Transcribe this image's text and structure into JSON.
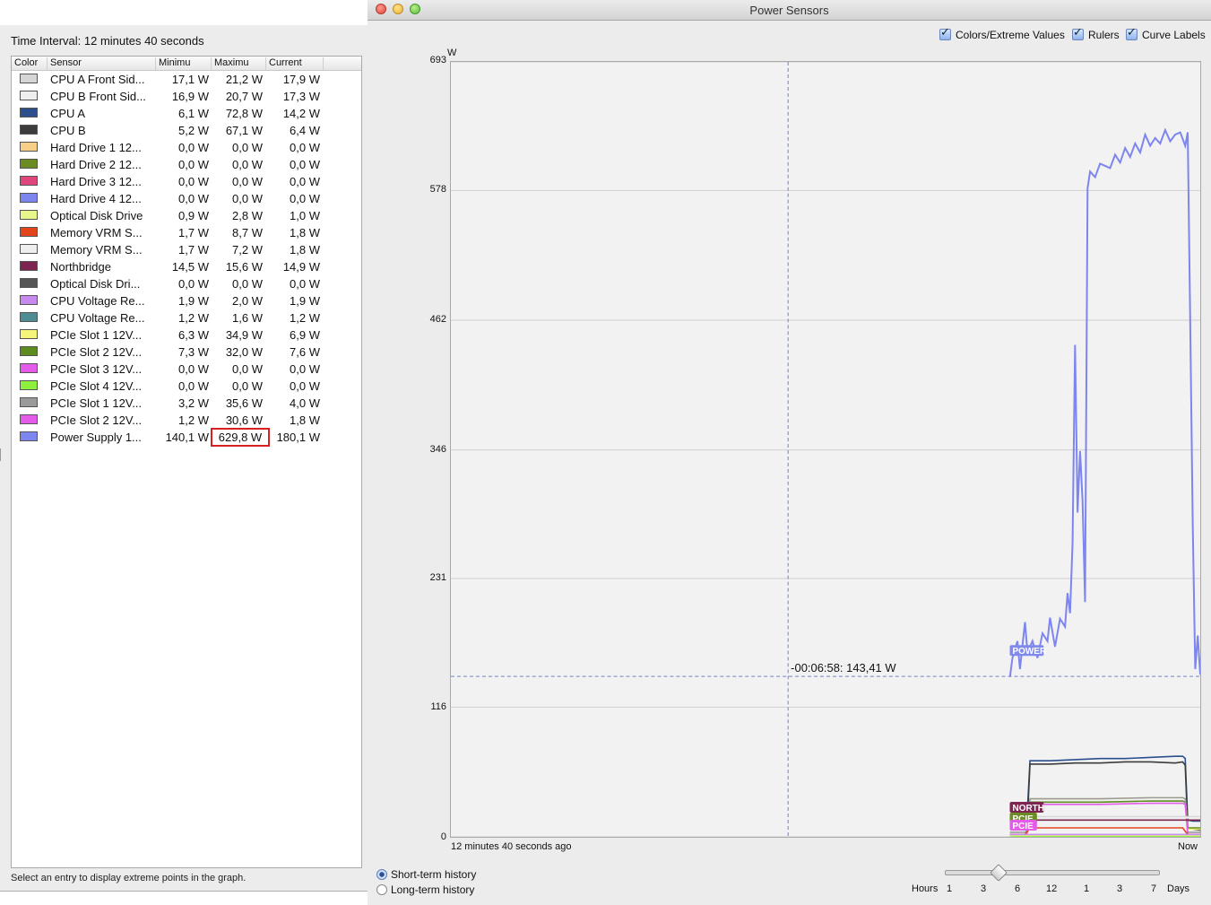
{
  "left": {
    "time_interval": "Time Interval: 12 minutes 40 seconds",
    "columns": [
      "Color",
      "Sensor",
      "Minimu",
      "Maximu",
      "Current"
    ],
    "status": "Select an entry to display extreme points in the graph.",
    "sensors": [
      {
        "color": "#d6d6d6",
        "name": "CPU A Front Sid...",
        "min": "17,1 W",
        "max": "21,2 W",
        "current": "17,9 W"
      },
      {
        "color": "#eeeeee",
        "name": "CPU B Front Sid...",
        "min": "16,9 W",
        "max": "20,7 W",
        "current": "17,3 W"
      },
      {
        "color": "#2a4f8c",
        "name": "CPU A",
        "min": "6,1 W",
        "max": "72,8 W",
        "current": "14,2 W"
      },
      {
        "color": "#3c3c3c",
        "name": "CPU B",
        "min": "5,2 W",
        "max": "67,1 W",
        "current": "6,4 W"
      },
      {
        "color": "#f7cf86",
        "name": "Hard Drive 1 12...",
        "min": "0,0 W",
        "max": "0,0 W",
        "current": "0,0 W"
      },
      {
        "color": "#6b8c23",
        "name": "Hard Drive 2 12...",
        "min": "0,0 W",
        "max": "0,0 W",
        "current": "0,0 W"
      },
      {
        "color": "#e0457e",
        "name": "Hard Drive 3 12...",
        "min": "0,0 W",
        "max": "0,0 W",
        "current": "0,0 W"
      },
      {
        "color": "#7d85ee",
        "name": "Hard Drive 4 12...",
        "min": "0,0 W",
        "max": "0,0 W",
        "current": "0,0 W"
      },
      {
        "color": "#e8f58a",
        "name": "Optical Disk Drive",
        "min": "0,9 W",
        "max": "2,8 W",
        "current": "1,0 W"
      },
      {
        "color": "#e2441c",
        "name": "Memory VRM S...",
        "min": "1,7 W",
        "max": "8,7 W",
        "current": "1,8 W"
      },
      {
        "color": "#eeeeee",
        "name": "Memory VRM S...",
        "min": "1,7 W",
        "max": "7,2 W",
        "current": "1,8 W"
      },
      {
        "color": "#7d2450",
        "name": "Northbridge",
        "min": "14,5 W",
        "max": "15,6 W",
        "current": "14,9 W"
      },
      {
        "color": "#555555",
        "name": "Optical Disk Dri...",
        "min": "0,0 W",
        "max": "0,0 W",
        "current": "0,0 W"
      },
      {
        "color": "#c889ee",
        "name": "CPU Voltage Re...",
        "min": "1,9 W",
        "max": "2,0 W",
        "current": "1,9 W"
      },
      {
        "color": "#4f8d94",
        "name": "CPU Voltage Re...",
        "min": "1,2 W",
        "max": "1,6 W",
        "current": "1,2 W"
      },
      {
        "color": "#f6f57a",
        "name": "PCIe Slot 1 12V...",
        "min": "6,3 W",
        "max": "34,9 W",
        "current": "6,9 W"
      },
      {
        "color": "#5c8c1e",
        "name": "PCIe Slot 2 12V...",
        "min": "7,3 W",
        "max": "32,0 W",
        "current": "7,6 W"
      },
      {
        "color": "#e35be8",
        "name": "PCIe Slot 3 12V...",
        "min": "0,0 W",
        "max": "0,0 W",
        "current": "0,0 W"
      },
      {
        "color": "#8ef03c",
        "name": "PCIe Slot 4 12V...",
        "min": "0,0 W",
        "max": "0,0 W",
        "current": "0,0 W"
      },
      {
        "color": "#9a9a9a",
        "name": "PCIe Slot 1 12V...",
        "min": "3,2 W",
        "max": "35,6 W",
        "current": "4,0 W"
      },
      {
        "color": "#e35be8",
        "name": "PCIe Slot 2 12V...",
        "min": "1,2 W",
        "max": "30,6 W",
        "current": "1,8 W"
      },
      {
        "color": "#7d85ee",
        "name": "Power Supply 1...",
        "min": "140,1 W",
        "max": "629,8 W",
        "current": "180,1 W",
        "highlight_max": true
      }
    ]
  },
  "window": {
    "title": "Power Sensors",
    "options": [
      {
        "label": "Colors/Extreme Values",
        "checked": true
      },
      {
        "label": "Rulers",
        "checked": true
      },
      {
        "label": "Curve Labels",
        "checked": true
      }
    ],
    "history": {
      "short_label": "Short-term history",
      "long_label": "Long-term history",
      "selected": "short"
    },
    "scale": {
      "hours_label": "Hours",
      "ticks": [
        "1",
        "3",
        "6",
        "12",
        "1",
        "3",
        "7"
      ],
      "days_label": "Days"
    }
  },
  "chart_data": {
    "type": "line",
    "ylabel": "W",
    "yticks": [
      "693",
      "578",
      "462",
      "346",
      "231",
      "116",
      "0"
    ],
    "ylim": [
      0,
      693
    ],
    "x_left_label": "12 minutes 40 seconds ago",
    "x_right_label": "Now",
    "x_domain_seconds_ago": [
      760,
      0
    ],
    "grid": true,
    "cursor": {
      "label": "-00:06:58: 143,41 W",
      "seconds_ago": 418,
      "value": 143.41
    },
    "curve_labels": [
      "POWER",
      "NORTH",
      "PCIE",
      "PCIE"
    ],
    "series": [
      {
        "name": "Power Supply 1...",
        "color": "#7d85ee",
        "points": [
          [
            76,
            143
          ],
          [
            75,
            160
          ],
          [
            73,
            175
          ],
          [
            72,
            150
          ],
          [
            70,
            192
          ],
          [
            69,
            165
          ],
          [
            67,
            175
          ],
          [
            65,
            160
          ],
          [
            63,
            182
          ],
          [
            61,
            175
          ],
          [
            60,
            196
          ],
          [
            58,
            170
          ],
          [
            56,
            195
          ],
          [
            54,
            188
          ],
          [
            53,
            218
          ],
          [
            52,
            200
          ],
          [
            51,
            262
          ],
          [
            50,
            440
          ],
          [
            49,
            290
          ],
          [
            48,
            345
          ],
          [
            47,
            300
          ],
          [
            46,
            210
          ],
          [
            45,
            580
          ],
          [
            44,
            595
          ],
          [
            42,
            590
          ],
          [
            40,
            602
          ],
          [
            38,
            600
          ],
          [
            36,
            598
          ],
          [
            34,
            610
          ],
          [
            32,
            603
          ],
          [
            30,
            616
          ],
          [
            28,
            608
          ],
          [
            26,
            620
          ],
          [
            24,
            612
          ],
          [
            22,
            628
          ],
          [
            20,
            618
          ],
          [
            18,
            625
          ],
          [
            16,
            620
          ],
          [
            14,
            632
          ],
          [
            12,
            622
          ],
          [
            10,
            628
          ],
          [
            8,
            630
          ],
          [
            7,
            624
          ],
          [
            6,
            618
          ],
          [
            5,
            630
          ],
          [
            4,
            460
          ],
          [
            3,
            280
          ],
          [
            2,
            150
          ],
          [
            1,
            180
          ],
          [
            0,
            145
          ]
        ]
      },
      {
        "name": "CPU A",
        "color": "#2a4f8c",
        "points": [
          [
            76,
            20
          ],
          [
            73,
            22
          ],
          [
            70,
            23
          ],
          [
            69,
            25
          ],
          [
            68,
            68
          ],
          [
            60,
            68
          ],
          [
            50,
            69
          ],
          [
            40,
            70
          ],
          [
            30,
            70
          ],
          [
            20,
            71
          ],
          [
            10,
            72
          ],
          [
            7,
            72
          ],
          [
            6,
            70
          ],
          [
            5,
            15
          ],
          [
            3,
            14
          ],
          [
            0,
            14
          ]
        ]
      },
      {
        "name": "CPU B",
        "color": "#3c3c3c",
        "points": [
          [
            76,
            12
          ],
          [
            73,
            14
          ],
          [
            70,
            15
          ],
          [
            69,
            17
          ],
          [
            68,
            65
          ],
          [
            60,
            65
          ],
          [
            50,
            66
          ],
          [
            40,
            66
          ],
          [
            30,
            67
          ],
          [
            20,
            67
          ],
          [
            10,
            66
          ],
          [
            7,
            67
          ],
          [
            6,
            64
          ],
          [
            5,
            8
          ],
          [
            3,
            7
          ],
          [
            0,
            6
          ]
        ]
      },
      {
        "name": "PCIe Slot 1 12V...",
        "color": "#f6f57a",
        "points": [
          [
            76,
            8
          ],
          [
            70,
            8
          ],
          [
            69,
            10
          ],
          [
            68,
            34
          ],
          [
            40,
            34
          ],
          [
            20,
            35
          ],
          [
            7,
            35
          ],
          [
            6,
            34
          ],
          [
            5,
            7
          ],
          [
            0,
            7
          ]
        ]
      },
      {
        "name": "PCIe Slot 2 12V...",
        "color": "#5c8c1e",
        "points": [
          [
            76,
            9
          ],
          [
            70,
            9
          ],
          [
            69,
            11
          ],
          [
            68,
            31
          ],
          [
            40,
            31
          ],
          [
            20,
            32
          ],
          [
            7,
            32
          ],
          [
            6,
            31
          ],
          [
            5,
            8
          ],
          [
            0,
            8
          ]
        ]
      },
      {
        "name": "PCIe Slot 1 12V...",
        "color": "#9a9a9a",
        "points": [
          [
            76,
            4
          ],
          [
            70,
            4
          ],
          [
            69,
            6
          ],
          [
            68,
            34
          ],
          [
            40,
            34
          ],
          [
            20,
            35
          ],
          [
            7,
            35
          ],
          [
            6,
            34
          ],
          [
            5,
            4
          ],
          [
            0,
            4
          ]
        ]
      },
      {
        "name": "PCIe Slot 2 12V...",
        "color": "#e35be8",
        "points": [
          [
            76,
            2
          ],
          [
            70,
            2
          ],
          [
            69,
            4
          ],
          [
            68,
            29
          ],
          [
            40,
            29
          ],
          [
            20,
            30
          ],
          [
            7,
            30
          ],
          [
            6,
            29
          ],
          [
            5,
            2
          ],
          [
            0,
            2
          ]
        ]
      },
      {
        "name": "CPU A Front Sid...",
        "color": "#d6d6d6",
        "points": [
          [
            76,
            18
          ],
          [
            0,
            18
          ]
        ]
      },
      {
        "name": "CPU B Front Sid...",
        "color": "#eeeeee",
        "points": [
          [
            76,
            17
          ],
          [
            0,
            17
          ]
        ]
      },
      {
        "name": "Northbridge",
        "color": "#7d2450",
        "points": [
          [
            76,
            15
          ],
          [
            0,
            15
          ]
        ]
      },
      {
        "name": "Memory VRM S...",
        "color": "#e2441c",
        "points": [
          [
            76,
            2
          ],
          [
            70,
            2
          ],
          [
            68,
            8
          ],
          [
            7,
            8
          ],
          [
            5,
            2
          ],
          [
            0,
            2
          ]
        ]
      },
      {
        "name": "Optical Disk Drive",
        "color": "#e8f58a",
        "points": [
          [
            76,
            1
          ],
          [
            0,
            1
          ]
        ]
      },
      {
        "name": "CPU Voltage Re...",
        "color": "#c889ee",
        "points": [
          [
            76,
            2
          ],
          [
            0,
            2
          ]
        ]
      },
      {
        "name": "PCIe Slot 4 12V...",
        "color": "#8ef03c",
        "points": [
          [
            76,
            0
          ],
          [
            0,
            0
          ]
        ]
      }
    ]
  }
}
